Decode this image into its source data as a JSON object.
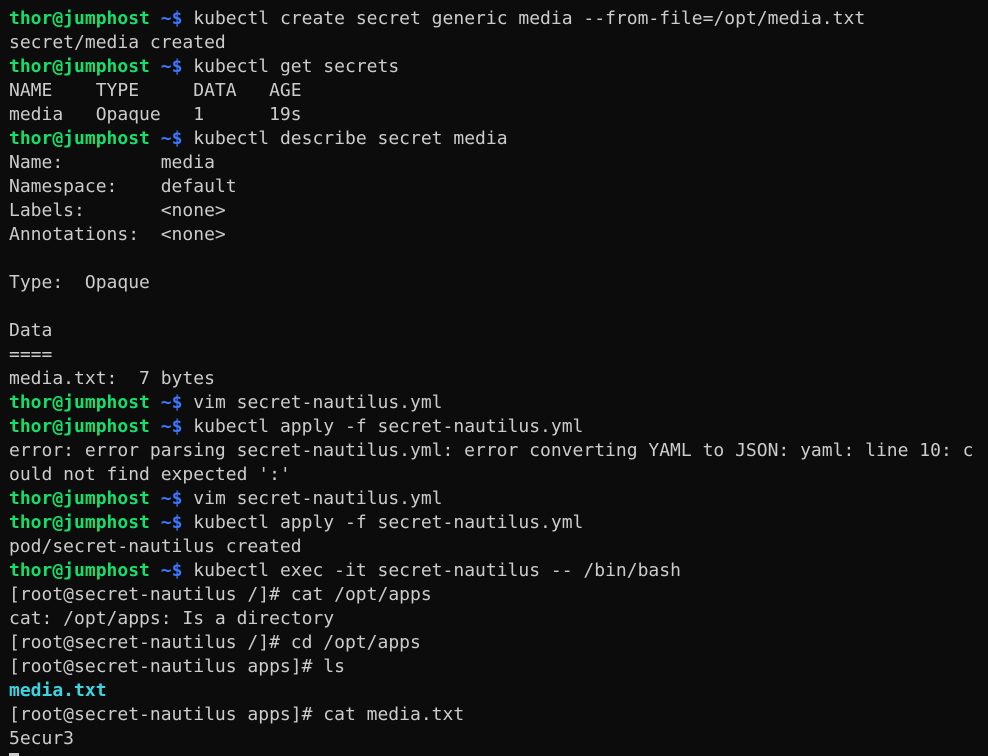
{
  "terminal": {
    "colors": {
      "background": "#0c0c0c",
      "text": "#cccccc",
      "prompt_user": "#13e06a",
      "prompt_tilde": "#3b78ff",
      "directory": "#3ad6e0"
    },
    "prompt_user": "thor@jumphost",
    "prompt_dir": "~$",
    "container_prompt_root": "[root@secret-nautilus /]#",
    "container_prompt_apps": "[root@secret-nautilus apps]#",
    "lines": [
      {
        "kind": "prompt",
        "cmd": "kubectl create secret generic media --from-file=/opt/media.txt"
      },
      {
        "kind": "output",
        "text": "secret/media created"
      },
      {
        "kind": "prompt",
        "cmd": "kubectl get secrets"
      },
      {
        "kind": "output",
        "text": "NAME    TYPE     DATA   AGE"
      },
      {
        "kind": "output",
        "text": "media   Opaque   1      19s"
      },
      {
        "kind": "prompt",
        "cmd": "kubectl describe secret media"
      },
      {
        "kind": "output",
        "text": "Name:         media"
      },
      {
        "kind": "output",
        "text": "Namespace:    default"
      },
      {
        "kind": "output",
        "text": "Labels:       <none>"
      },
      {
        "kind": "output",
        "text": "Annotations:  <none>"
      },
      {
        "kind": "output",
        "text": ""
      },
      {
        "kind": "output",
        "text": "Type:  Opaque"
      },
      {
        "kind": "output",
        "text": ""
      },
      {
        "kind": "output",
        "text": "Data"
      },
      {
        "kind": "output",
        "text": "===="
      },
      {
        "kind": "output",
        "text": "media.txt:  7 bytes"
      },
      {
        "kind": "prompt",
        "cmd": "vim secret-nautilus.yml"
      },
      {
        "kind": "prompt",
        "cmd": "kubectl apply -f secret-nautilus.yml"
      },
      {
        "kind": "output",
        "text": "error: error parsing secret-nautilus.yml: error converting YAML to JSON: yaml: line 10: c"
      },
      {
        "kind": "output",
        "text": "ould not find expected ':'"
      },
      {
        "kind": "prompt",
        "cmd": "vim secret-nautilus.yml"
      },
      {
        "kind": "prompt",
        "cmd": "kubectl apply -f secret-nautilus.yml"
      },
      {
        "kind": "output",
        "text": "pod/secret-nautilus created"
      },
      {
        "kind": "prompt",
        "cmd": "kubectl exec -it secret-nautilus -- /bin/bash"
      },
      {
        "kind": "root",
        "prompt": "[root@secret-nautilus /]#",
        "cmd": "cat /opt/apps"
      },
      {
        "kind": "output",
        "text": "cat: /opt/apps: Is a directory"
      },
      {
        "kind": "root",
        "prompt": "[root@secret-nautilus /]#",
        "cmd": "cd /opt/apps"
      },
      {
        "kind": "root",
        "prompt": "[root@secret-nautilus apps]#",
        "cmd": "ls"
      },
      {
        "kind": "file",
        "text": "media.txt"
      },
      {
        "kind": "root",
        "prompt": "[root@secret-nautilus apps]#",
        "cmd": "cat media.txt"
      },
      {
        "kind": "output",
        "text": "5ecur3"
      },
      {
        "kind": "cursor"
      }
    ]
  }
}
